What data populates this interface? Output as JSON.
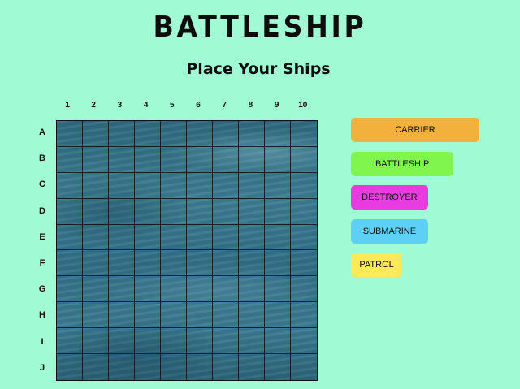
{
  "title": "BATTLESHIP",
  "subtitle": "Place Your Ships",
  "columns": [
    "1",
    "2",
    "3",
    "4",
    "5",
    "6",
    "7",
    "8",
    "9",
    "10"
  ],
  "rows": [
    "A",
    "B",
    "C",
    "D",
    "E",
    "F",
    "G",
    "H",
    "I",
    "J"
  ],
  "ships": [
    {
      "name": "CARRIER",
      "length": 5,
      "color": "#f2b13c"
    },
    {
      "name": "BATTLESHIP",
      "length": 4,
      "color": "#80f54e"
    },
    {
      "name": "DESTROYER",
      "length": 3,
      "color": "#e83ce0"
    },
    {
      "name": "SUBMARINE",
      "length": 3,
      "color": "#5ed0f5"
    },
    {
      "name": "PATROL",
      "length": 2,
      "color": "#fbe957"
    }
  ],
  "board_background": "ocean-water-texture"
}
